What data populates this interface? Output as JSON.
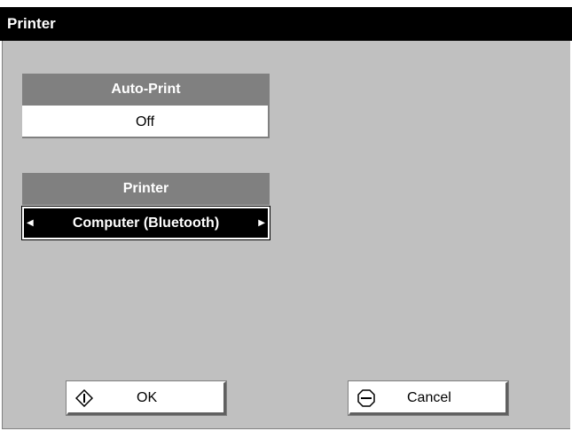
{
  "window": {
    "title": "Printer"
  },
  "auto_print": {
    "label": "Auto-Print",
    "value": "Off"
  },
  "printer": {
    "label": "Printer",
    "value": "Computer (Bluetooth)"
  },
  "buttons": {
    "ok": {
      "label": "OK",
      "icon": "diamond-info-icon"
    },
    "cancel": {
      "label": "Cancel",
      "icon": "stop-octagon-icon"
    }
  },
  "colors": {
    "titlebar": "#000000",
    "panel": "#c0c0c0",
    "group_header": "#808080",
    "selected_value": "#000000"
  }
}
